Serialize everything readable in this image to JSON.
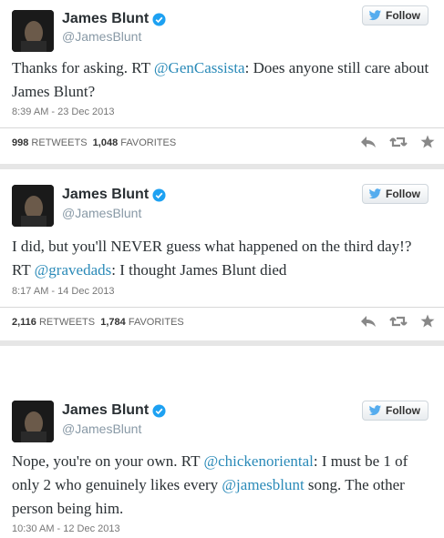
{
  "tweets": [
    {
      "name": "James Blunt",
      "handle": "@JamesBlunt",
      "follow_label": "Follow",
      "text_parts": [
        "Thanks for asking. RT ",
        "@GenCassista",
        ": Does anyone still care about James Blunt?"
      ],
      "time": "8:39 AM - 23 Dec 2013",
      "retweets": "998",
      "retweets_label": "RETWEETS",
      "favorites": "1,048",
      "favorites_label": "FAVORITES"
    },
    {
      "name": "James Blunt",
      "handle": "@JamesBlunt",
      "follow_label": "Follow",
      "text_parts": [
        "I did, but you'll NEVER guess what happened on the third day!? RT ",
        "@gravedads",
        ": I thought James Blunt died"
      ],
      "time": "8:17 AM - 14 Dec 2013",
      "retweets": "2,116",
      "retweets_label": "RETWEETS",
      "favorites": "1,784",
      "favorites_label": "FAVORITES"
    },
    {
      "name": "James Blunt",
      "handle": "@JamesBlunt",
      "follow_label": "Follow",
      "text_parts": [
        "Nope, you're on your own. RT ",
        "@chickenoriental",
        ": I must be 1 of only 2 who genuinely likes every ",
        "@jamesblunt",
        " song. The other person being him."
      ],
      "time": "10:30 AM - 12 Dec 2013"
    }
  ],
  "colors": {
    "mention": "#2a8ab8",
    "verified": "#1da1f2",
    "bird": "#55acee"
  }
}
